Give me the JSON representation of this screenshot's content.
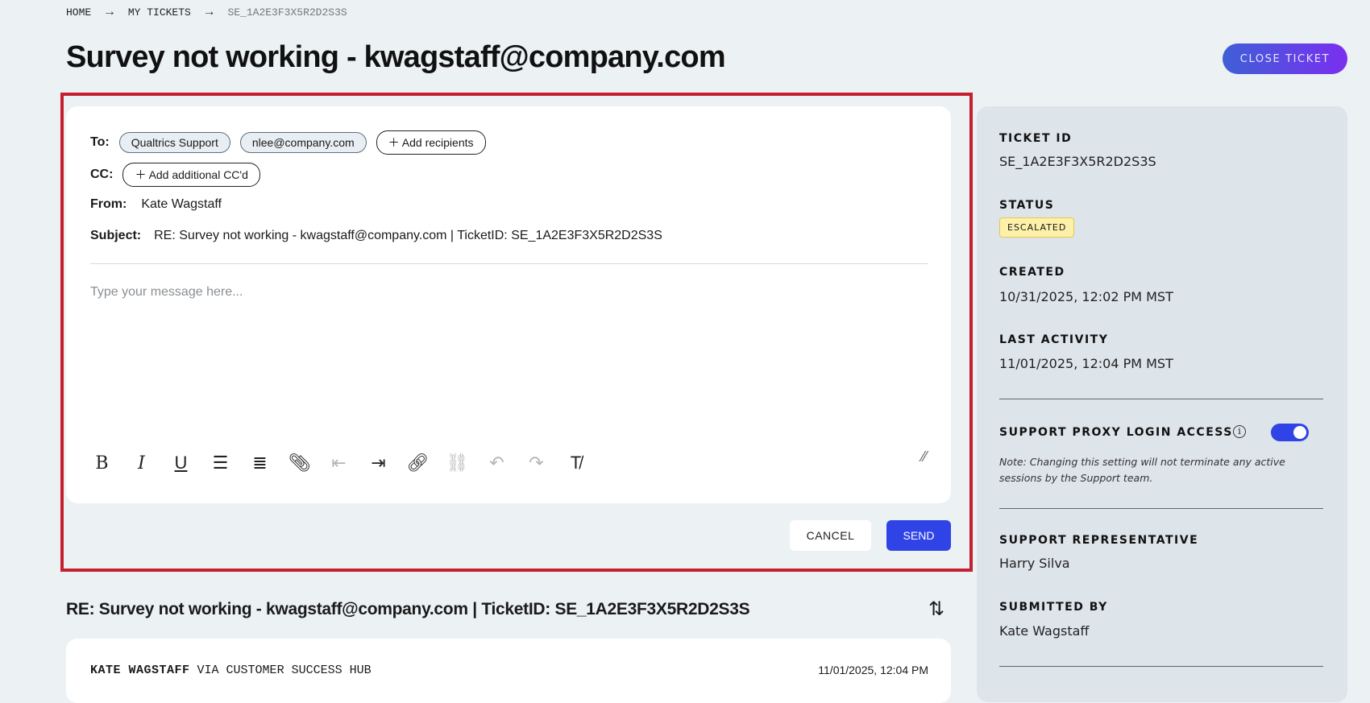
{
  "breadcrumb": {
    "items": [
      "HOME",
      "MY TICKETS",
      "SE_1A2E3F3X5R2D2S3S"
    ]
  },
  "page_title": "Survey not working - kwagstaff@company.com",
  "close_ticket_label": "CLOSE TICKET",
  "compose": {
    "to_label": "To:",
    "to_recipients": [
      "Qualtrics Support",
      "nlee@company.com"
    ],
    "add_recipients": "Add recipients",
    "cc_label": "CC:",
    "add_cc": "Add additional CC'd",
    "from_label": "From:",
    "from_value": "Kate Wagstaff",
    "subject_label": "Subject:",
    "subject_value": "RE: Survey not working - kwagstaff@company.com | TicketID: SE_1A2E3F3X5R2D2S3S",
    "placeholder": "Type your message here...",
    "cancel_label": "CANCEL",
    "send_label": "SEND"
  },
  "thread": {
    "subject": "RE: Survey not working - kwagstaff@company.com | TicketID: SE_1A2E3F3X5R2D2S3S",
    "messages": [
      {
        "author": "KATE WAGSTAFF",
        "via": "VIA CUSTOMER SUCCESS HUB",
        "timestamp": "11/01/2025, 12:04 PM"
      }
    ]
  },
  "details": {
    "ticket_id_label": "TICKET ID",
    "ticket_id": "SE_1A2E3F3X5R2D2S3S",
    "status_label": "STATUS",
    "status": "ESCALATED",
    "created_label": "CREATED",
    "created": "10/31/2025, 12:02 PM MST",
    "last_activity_label": "LAST ACTIVITY",
    "last_activity": "11/01/2025, 12:04 PM MST",
    "proxy_label": "SUPPORT PROXY LOGIN ACCESS",
    "proxy_enabled": true,
    "proxy_note": "Note: Changing this setting will not terminate any active sessions by the Support team.",
    "rep_label": "SUPPORT REPRESENTATIVE",
    "rep": "Harry Silva",
    "submitted_label": "SUBMITTED BY",
    "submitted": "Kate Wagstaff"
  },
  "colors": {
    "accent": "#2f43e6",
    "highlight_border": "#c4202f",
    "badge_bg": "#fdf0a8"
  }
}
